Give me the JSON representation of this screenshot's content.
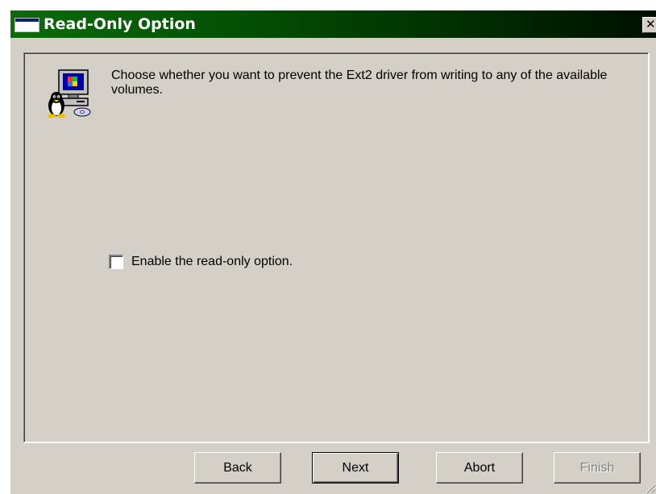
{
  "window": {
    "title": "Read-Only Option",
    "close_glyph": "✕",
    "title_icon": "window-icon",
    "title_gradient": [
      "#0c6b0c",
      "#000f00"
    ]
  },
  "content": {
    "icon": "computer-penguin-icon",
    "description": "Choose whether you want to prevent the Ext2 driver from writing to any of the available volumes.",
    "readonly_checkbox": {
      "label": "Enable the read-only option.",
      "checked": false
    }
  },
  "buttons": {
    "back": {
      "label": "Back",
      "enabled": true
    },
    "next": {
      "label": "Next",
      "enabled": true,
      "default": true
    },
    "abort": {
      "label": "Abort",
      "enabled": true
    },
    "finish": {
      "label": "Finish",
      "enabled": false
    }
  }
}
